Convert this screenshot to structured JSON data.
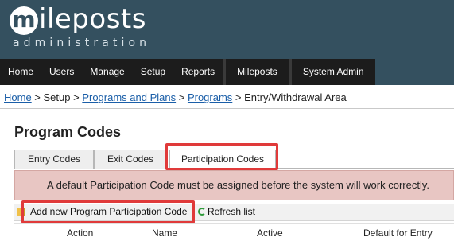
{
  "brand": {
    "initial": "m",
    "name": "ileposts",
    "tagline": "administration"
  },
  "nav": {
    "group1": [
      "Home",
      "Users",
      "Manage",
      "Setup",
      "Reports"
    ],
    "group2": [
      "Mileposts"
    ],
    "group3": [
      "System Admin"
    ]
  },
  "breadcrumb": {
    "home": "Home",
    "sep": " > ",
    "setup": "Setup",
    "programs_plans": "Programs and Plans",
    "programs": "Programs",
    "current": "Entry/Withdrawal Area"
  },
  "page": {
    "title": "Program Codes"
  },
  "tabs": [
    {
      "label": "Entry Codes"
    },
    {
      "label": "Exit Codes"
    },
    {
      "label": "Participation Codes"
    }
  ],
  "alert": {
    "text": "A default Participation Code must be assigned before the system will work correctly."
  },
  "toolbar": {
    "add_label": "Add new Program Participation Code",
    "refresh_label": "Refresh list"
  },
  "table": {
    "columns": [
      "Action",
      "Name",
      "Active",
      "Default for Entry"
    ]
  },
  "colors": {
    "header_bg": "#34505f",
    "nav_bg": "#1c1c1c",
    "alert_bg": "#e8c6c3",
    "highlight": "#e03a3a",
    "link": "#1a5ea8"
  }
}
